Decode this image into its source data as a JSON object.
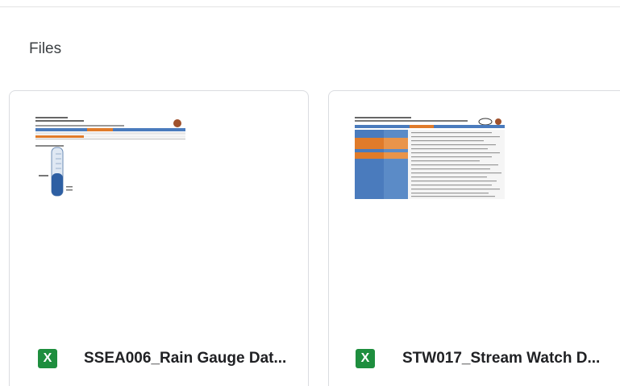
{
  "section": {
    "title": "Files"
  },
  "files": [
    {
      "icon": "excel-icon",
      "icon_letter": "X",
      "name": "SSEA006_Rain Gauge Dat...",
      "icon_color": "#1e8e3e"
    },
    {
      "icon": "excel-icon",
      "icon_letter": "X",
      "name": "STW017_Stream Watch D...",
      "icon_color": "#1e8e3e"
    }
  ],
  "colors": {
    "accent_orange": "#e07b2a",
    "accent_blue": "#4a7bbd",
    "border": "#dadce0"
  }
}
